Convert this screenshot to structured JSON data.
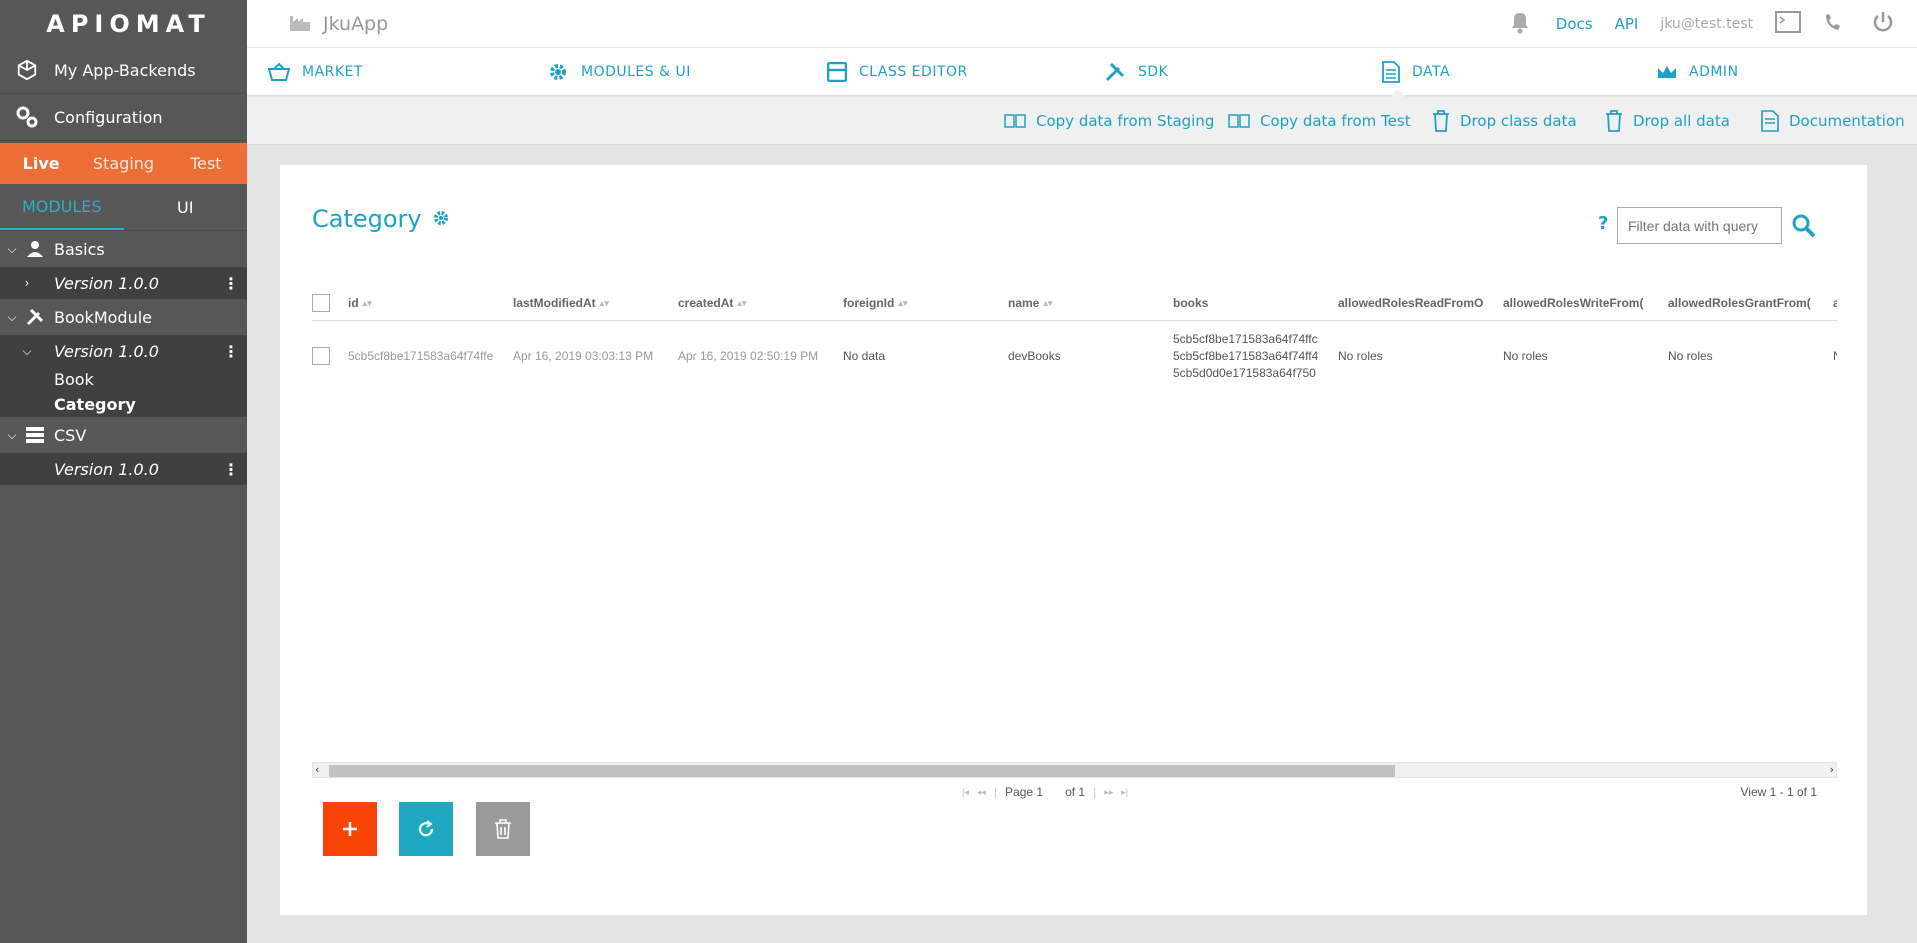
{
  "logo": "APIOMAT",
  "sidebar": {
    "nav": [
      {
        "label": "My App-Backends",
        "icon": "cube-icon"
      },
      {
        "label": "Configuration",
        "icon": "gears-icon"
      }
    ],
    "environments": [
      "Live",
      "Staging",
      "Test"
    ],
    "active_environment": "Live",
    "tabs": [
      "MODULES",
      "UI"
    ],
    "modules": [
      {
        "name": "Basics",
        "icon": "user-icon",
        "version": "Version 1.0.0",
        "classes": []
      },
      {
        "name": "BookModule",
        "icon": "tools-icon",
        "version": "Version 1.0.0",
        "classes": [
          "Book",
          "Category"
        ]
      },
      {
        "name": "CSV",
        "icon": "server-icon",
        "version": "Version 1.0.0",
        "classes": []
      }
    ]
  },
  "topbar": {
    "app_name": "JkuApp",
    "docs": "Docs",
    "api": "API",
    "user": "jku@test.test"
  },
  "navbar": {
    "items": [
      "MARKET",
      "MODULES & UI",
      "CLASS EDITOR",
      "SDK",
      "DATA",
      "ADMIN"
    ],
    "active": "DATA"
  },
  "actions": [
    "Copy data from Staging",
    "Copy data from Test",
    "Drop class data",
    "Drop all data",
    "Documentation"
  ],
  "page": {
    "title": "Category",
    "help": "?",
    "filter_placeholder": "Filter data with query"
  },
  "table": {
    "columns": [
      "id",
      "lastModifiedAt",
      "createdAt",
      "foreignId",
      "name",
      "books",
      "allowedRolesReadFromO",
      "allowedRolesWriteFrom(",
      "allowedRolesGrantFrom(",
      "a"
    ],
    "rows": [
      {
        "id": "5cb5cf8be171583a64f74ffe",
        "lastModifiedAt": "Apr 16, 2019 03:03:13 PM",
        "createdAt": "Apr 16, 2019 02:50:19 PM",
        "foreignId": "No data",
        "name": "devBooks",
        "books": [
          "5cb5cf8be171583a64f74ffc",
          "5cb5cf8be171583a64f74ff4",
          "5cb5d0d0e171583a64f750"
        ],
        "allowedRolesRead": "No roles",
        "allowedRolesWrite": "No roles",
        "allowedRolesGrant": "No roles",
        "extra": "N"
      }
    ]
  },
  "pager": {
    "page_label": "Page 1",
    "of_label": "of 1",
    "view": "View 1 - 1 of 1"
  },
  "colors": {
    "accent": "#1fa1c6",
    "env_bar": "#ec6e36",
    "sidebar": "#575757",
    "add": "#fa4407",
    "refresh": "#1fa8c0",
    "delete": "#9a9a9a"
  }
}
